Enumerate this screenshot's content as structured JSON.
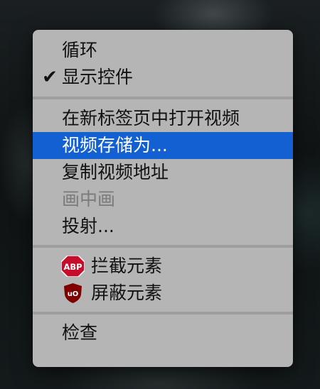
{
  "menu": {
    "loop_label": "循环",
    "show_controls_label": "显示控件",
    "show_controls_check": "✔",
    "open_in_new_tab_label": "在新标签页中打开视频",
    "save_video_as_label": "视频存储为...",
    "copy_video_address_label": "复制视频地址",
    "picture_in_picture_label": "画中画",
    "cast_label": "投射...",
    "block_element_label": "拦截元素",
    "abp_icon_text": "ABP",
    "hide_element_label": "屏蔽元素",
    "ublock_icon_text": "uO",
    "inspect_label": "检查"
  },
  "colors": {
    "menu_background": "#b5b5b5",
    "selection_highlight": "#1260d2",
    "disabled_text": "#7b7b7b",
    "abp_red": "#c70d2c",
    "ublock_red": "#800000"
  }
}
